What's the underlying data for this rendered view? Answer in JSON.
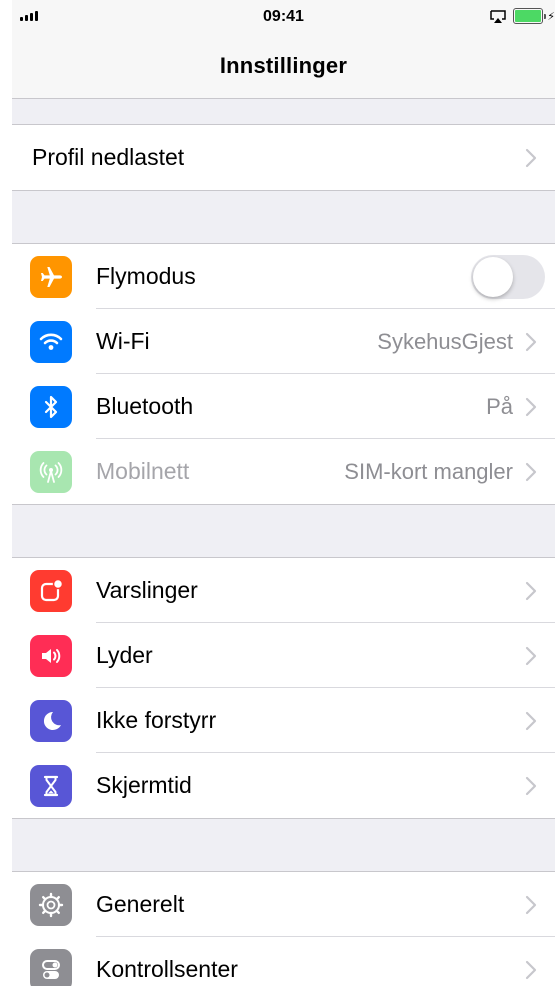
{
  "status_bar": {
    "time": "09:41"
  },
  "nav": {
    "title": "Innstillinger"
  },
  "profile_row": {
    "label": "Profil nedlastet"
  },
  "connectivity": {
    "airplane": {
      "label": "Flymodus",
      "toggle_on": false,
      "icon_color": "#ff9500"
    },
    "wifi": {
      "label": "Wi-Fi",
      "value": "SykehusGjest",
      "icon_color": "#007aff"
    },
    "bluetooth": {
      "label": "Bluetooth",
      "value": "På",
      "icon_color": "#007aff"
    },
    "cellular": {
      "label": "Mobilnett",
      "value": "SIM-kort mangler",
      "icon_color": "#a8e6b0"
    }
  },
  "notifications_group": {
    "notifications": {
      "label": "Varslinger",
      "icon_color": "#ff3b30"
    },
    "sounds": {
      "label": "Lyder",
      "icon_color": "#ff2d55"
    },
    "dnd": {
      "label": "Ikke forstyrr",
      "icon_color": "#5856d6"
    },
    "screentime": {
      "label": "Skjermtid",
      "icon_color": "#5856d6"
    }
  },
  "general_group": {
    "general": {
      "label": "Generelt",
      "icon_color": "#8e8e93"
    },
    "control_center": {
      "label": "Kontrollsenter",
      "icon_color": "#8e8e93"
    }
  }
}
